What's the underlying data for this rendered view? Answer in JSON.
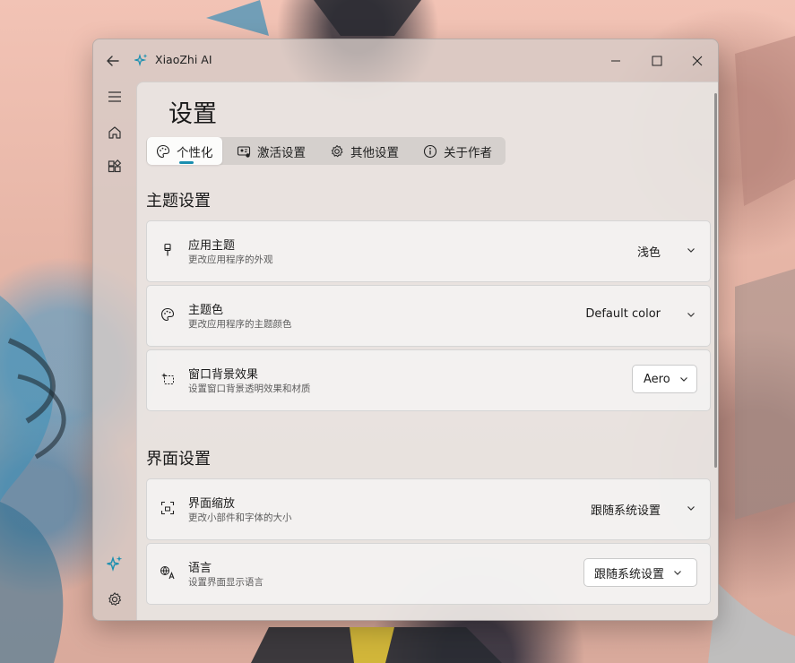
{
  "window": {
    "app_title": "XiaoZhi AI",
    "back_icon": "arrow-left-icon",
    "app_icon": "sparkle-icon",
    "controls": [
      "minimize-icon",
      "maximize-icon",
      "close-icon"
    ]
  },
  "nav": {
    "items": [
      {
        "icon": "hamburger-menu-icon"
      },
      {
        "icon": "home-icon"
      },
      {
        "icon": "apps-grid-icon"
      },
      {
        "icon": "sparkle-icon"
      },
      {
        "icon": "settings-gear-icon",
        "selected": true
      }
    ]
  },
  "page": {
    "title": "设置",
    "tabs": [
      {
        "label": "个性化",
        "icon": "palette-icon",
        "selected": true
      },
      {
        "label": "激活设置",
        "icon": "activation-icon"
      },
      {
        "label": "其他设置",
        "icon": "gear-icon"
      },
      {
        "label": "关于作者",
        "icon": "info-icon"
      }
    ]
  },
  "theme_section": {
    "title": "主题设置",
    "cards": [
      {
        "title": "应用主题",
        "subtitle": "更改应用程序的外观",
        "value": "浅色",
        "icon": "brush-icon"
      },
      {
        "title": "主题色",
        "subtitle": "更改应用程序的主题颜色",
        "value": "Default color",
        "icon": "palette-icon"
      },
      {
        "title": "窗口背景效果",
        "subtitle": "设置窗口背景透明效果和材质",
        "value": "Aero",
        "icon": "background-effect-icon"
      }
    ]
  },
  "ui_section": {
    "title": "界面设置",
    "cards": [
      {
        "title": "界面缩放",
        "subtitle": "更改小部件和字体的大小",
        "value": "跟随系统设置",
        "icon": "scale-icon"
      },
      {
        "title": "语言",
        "subtitle": "设置界面显示语言",
        "value": "跟随系统设置",
        "icon": "language-icon"
      }
    ]
  },
  "colors": {
    "accent": "#1a8fb0"
  }
}
